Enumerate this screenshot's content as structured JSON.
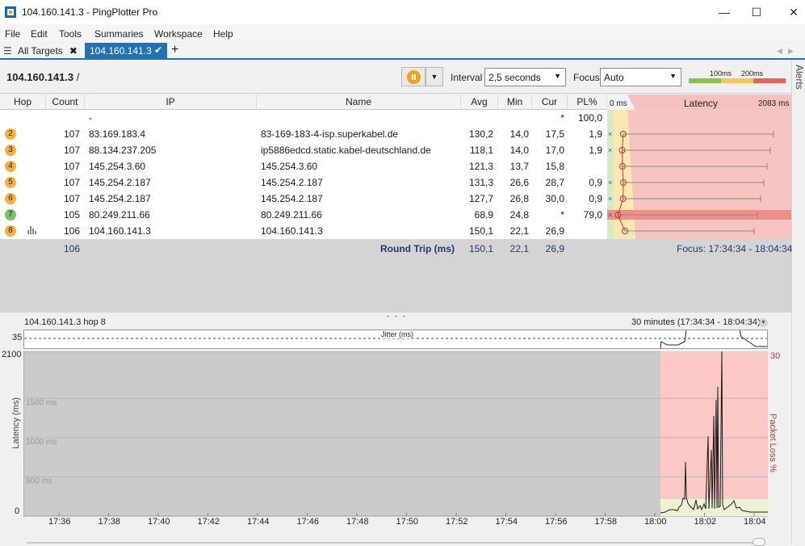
{
  "window": {
    "title": "104.160.141.3 - PingPlotter Pro",
    "controls": {
      "minimize": "—",
      "maximize": "☐",
      "close": "✕"
    }
  },
  "menu": [
    "File",
    "Edit",
    "Tools",
    "Summaries",
    "Workspace",
    "Help"
  ],
  "tabs": {
    "all_targets": "All Targets",
    "active": "104.160.141.3",
    "add": "+"
  },
  "toolbar": {
    "breadcrumb_target": "104.160.141.3",
    "breadcrumb_sep": " /",
    "interval_label": "Interval",
    "interval_value": "2,5 seconds",
    "focus_label": "Focus",
    "focus_value": "Auto",
    "legend_100": "100ms",
    "legend_200": "200ms"
  },
  "alerts_label": "Alerts",
  "table": {
    "headers": [
      "Hop",
      "Count",
      "IP",
      "Name",
      "Avg",
      "Min",
      "Cur",
      "PL%"
    ],
    "latency_header": {
      "left": "0 ms",
      "center": "Latency",
      "right": "2083 ms"
    },
    "rows": [
      {
        "hop": "",
        "count": "",
        "ip": "-",
        "name": "",
        "avg": "",
        "min": "",
        "cur": "*",
        "pl": "100,0",
        "badge_color": ""
      },
      {
        "hop": "2",
        "count": "107",
        "ip": "83.169.183.4",
        "name": "83-169-183-4-isp.superkabel.de",
        "avg": "130,2",
        "min": "14,0",
        "cur": "17,5",
        "pl": "1,9",
        "badge_color": "#f5b041"
      },
      {
        "hop": "3",
        "count": "107",
        "ip": "88.134.237.205",
        "name": "ip5886edcd.static.kabel-deutschland.de",
        "avg": "118,1",
        "min": "14,0",
        "cur": "17,0",
        "pl": "1,9",
        "badge_color": "#f5b041"
      },
      {
        "hop": "4",
        "count": "107",
        "ip": "145.254.3.60",
        "name": "145.254.3.60",
        "avg": "121,3",
        "min": "13,7",
        "cur": "15,8",
        "pl": "",
        "badge_color": "#f5b041"
      },
      {
        "hop": "5",
        "count": "107",
        "ip": "145.254.2.187",
        "name": "145.254.2.187",
        "avg": "131,3",
        "min": "26,6",
        "cur": "28,7",
        "pl": "0,9",
        "badge_color": "#f5b041"
      },
      {
        "hop": "6",
        "count": "107",
        "ip": "145.254.2.187",
        "name": "145.254.2.187",
        "avg": "127,7",
        "min": "26,8",
        "cur": "30,0",
        "pl": "0,9",
        "badge_color": "#f5b041"
      },
      {
        "hop": "7",
        "count": "105",
        "ip": "80.249.211.66",
        "name": "80.249.211.66",
        "avg": "68,9",
        "min": "24,8",
        "cur": "*",
        "pl": "79,0",
        "badge_color": "#7cc06b"
      },
      {
        "hop": "8",
        "count": "106",
        "ip": "104.160.141.3",
        "name": "104.160.141.3",
        "avg": "150,1",
        "min": "22,1",
        "cur": "26,9",
        "pl": "",
        "badge_color": "#f5b041"
      }
    ],
    "summary": {
      "count": "106",
      "label": "Round Trip (ms)",
      "avg": "150,1",
      "min": "22,1",
      "cur": "26,9",
      "focus": "Focus: 17:34:34 - 18:04:34"
    }
  },
  "graph": {
    "title": "104.160.141.3 hop 8",
    "range": "30 minutes (17:34:34 - 18:04:34)",
    "jitter_label": "Jitter (ms)",
    "jitter_max": "35",
    "y_left_top": "2100",
    "y_left_bottom": "0",
    "y_right_top": "30",
    "gridlines": [
      "1500 ms",
      "1000 ms",
      "500 ms"
    ],
    "ylabel": "Latency (ms)",
    "ylabel_right": "Packet Loss %",
    "x_ticks": [
      "17:36",
      "17:38",
      "17:40",
      "17:42",
      "17:44",
      "17:46",
      "17:48",
      "17:50",
      "17:52",
      "17:54",
      "17:56",
      "17:58",
      "18:00",
      "18:02",
      "18:04"
    ]
  }
}
